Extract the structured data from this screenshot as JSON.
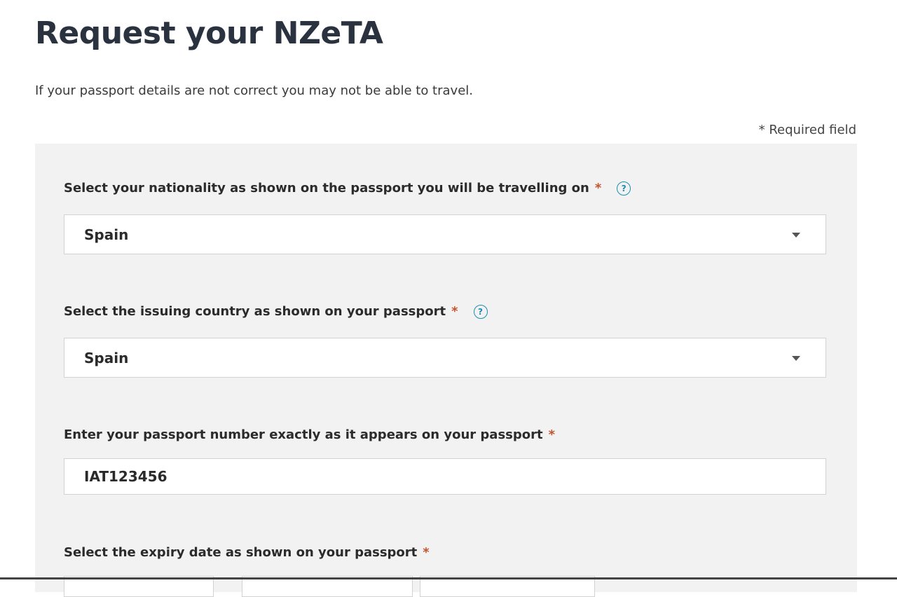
{
  "page": {
    "title": "Request your NZeTA",
    "intro": "If your passport details are not correct you may not be able to travel.",
    "required_note": "* Required field"
  },
  "form": {
    "nationality": {
      "label": "Select your nationality as shown on the passport you will be travelling on",
      "required_mark": "*",
      "help_icon": "?",
      "value": "Spain"
    },
    "issuing_country": {
      "label": "Select the issuing country as shown on your passport",
      "required_mark": "*",
      "help_icon": "?",
      "value": "Spain"
    },
    "passport_number": {
      "label": "Enter your passport number exactly as it appears on your passport",
      "required_mark": "*",
      "value": "IAT123456"
    },
    "expiry_date": {
      "label": "Select the expiry date as shown on your passport",
      "required_mark": "*"
    }
  },
  "icons": {
    "help": "question-circle-icon",
    "dropdown": "caret-down-icon"
  },
  "colors": {
    "title": "#2a3240",
    "required_asterisk": "#c2542f",
    "help_icon": "#1a8fb0",
    "panel_bg": "#f2f2f2"
  }
}
